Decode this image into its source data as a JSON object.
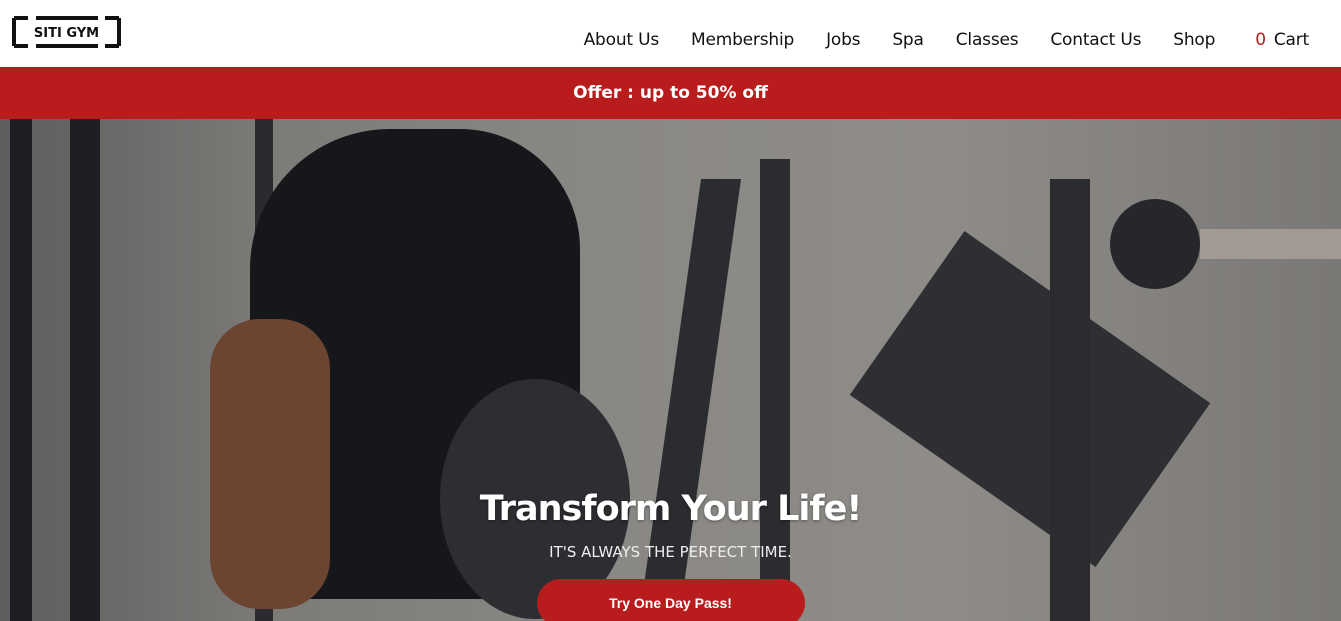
{
  "brand": {
    "logo_text": "SITI GYM"
  },
  "nav": {
    "items": [
      {
        "label": "About Us"
      },
      {
        "label": "Membership"
      },
      {
        "label": "Jobs"
      },
      {
        "label": "Spa"
      },
      {
        "label": "Classes"
      },
      {
        "label": "Contact Us"
      },
      {
        "label": "Shop"
      }
    ],
    "cart_count": "0",
    "cart_label": "Cart"
  },
  "offer": {
    "text": "Offer : up to 50% off"
  },
  "hero": {
    "title": "Transform Your Life!",
    "subtitle": "IT'S ALWAYS THE PERFECT TIME.",
    "cta_label": "Try One Day Pass!"
  },
  "colors": {
    "accent": "#b91c1c"
  }
}
